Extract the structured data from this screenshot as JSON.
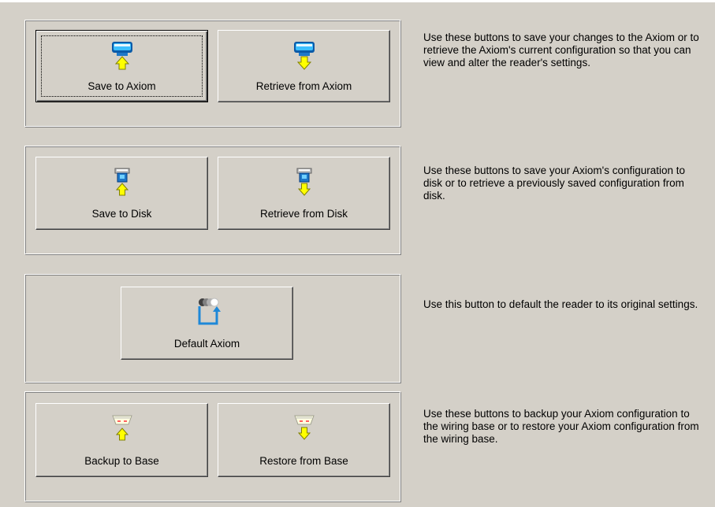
{
  "sections": [
    {
      "buttons": [
        {
          "label": "Save to Axiom",
          "icon": "axiom-save-icon"
        },
        {
          "label": "Retrieve from Axiom",
          "icon": "axiom-retrieve-icon"
        }
      ],
      "description": "Use these buttons to save your changes to the Axiom or to retrieve the Axiom's current configuration so that you can view and alter the reader's settings."
    },
    {
      "buttons": [
        {
          "label": "Save to Disk",
          "icon": "disk-save-icon"
        },
        {
          "label": "Retrieve from Disk",
          "icon": "disk-retrieve-icon"
        }
      ],
      "description": "Use these buttons to save your Axiom's configuration to disk or to retrieve a previously saved configuration from disk."
    },
    {
      "buttons": [
        {
          "label": "Default Axiom",
          "icon": "default-reset-icon"
        }
      ],
      "description": "Use this button to default the reader to its original settings."
    },
    {
      "buttons": [
        {
          "label": "Backup to Base",
          "icon": "base-backup-icon"
        },
        {
          "label": "Restore from Base",
          "icon": "base-restore-icon"
        }
      ],
      "description": "Use these buttons to backup your Axiom configuration to the wiring base or to restore your Axiom configuration from the wiring base."
    }
  ],
  "colors": {
    "background": "#d4d0c8",
    "arrow_yellow": "#ffff00",
    "icon_blue": "#1ea0f0"
  }
}
